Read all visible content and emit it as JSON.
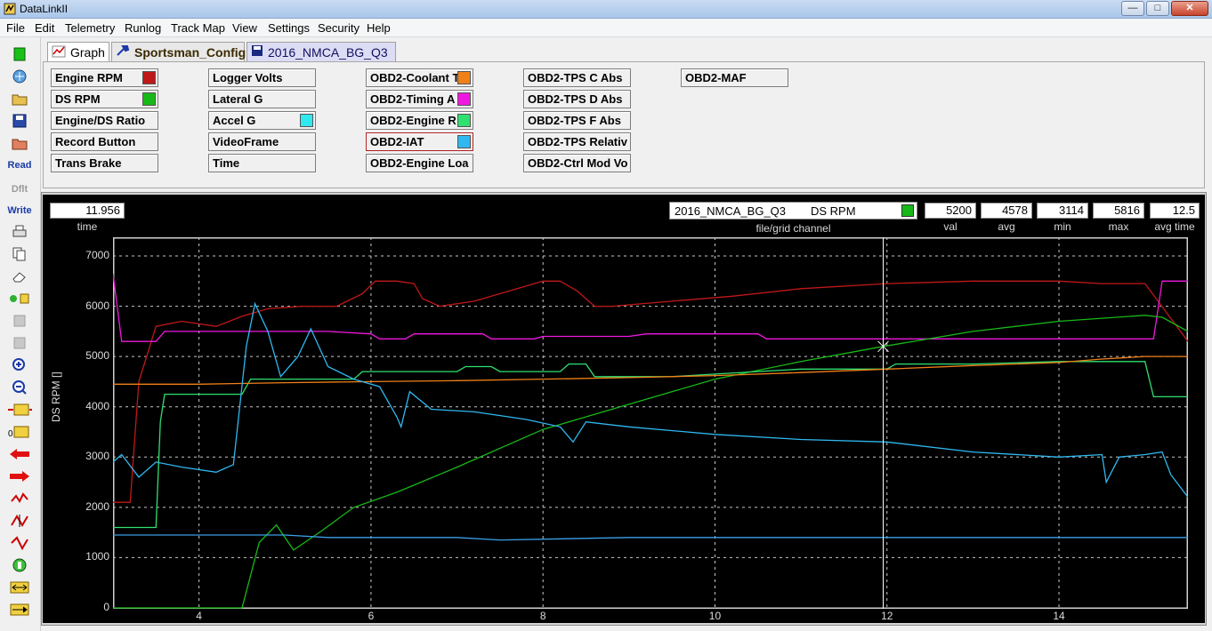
{
  "window": {
    "title": "DataLinkII",
    "min": "—",
    "max": "□",
    "close": "✕"
  },
  "menu": [
    "File",
    "Edit",
    "Telemetry",
    "Runlog",
    "Track Map",
    "View",
    "Settings",
    "Security",
    "Help"
  ],
  "toolbar": {
    "read": "Read",
    "dflt": "Dflt",
    "write": "Write"
  },
  "tabs": [
    {
      "label": "Graph",
      "icon": "graph-icon"
    },
    {
      "label": "Sportsman_Config",
      "icon": "wrench-icon"
    },
    {
      "label": "2016_NMCA_BG_Q3",
      "icon": "file-icon"
    }
  ],
  "channels": [
    {
      "label": "Engine RPM",
      "color": "#c01818"
    },
    {
      "label": "DS RPM",
      "color": "#18b818"
    },
    {
      "label": "Engine/DS Ratio",
      "color": ""
    },
    {
      "label": "Record Button",
      "color": ""
    },
    {
      "label": "Trans Brake",
      "color": ""
    },
    {
      "label": "Logger Volts",
      "color": ""
    },
    {
      "label": "Lateral G",
      "color": ""
    },
    {
      "label": "Accel G",
      "color": "#30e8f0"
    },
    {
      "label": "VideoFrame",
      "color": ""
    },
    {
      "label": "Time",
      "color": ""
    },
    {
      "label": "OBD2-Coolant T",
      "color": "#f08018"
    },
    {
      "label": "OBD2-Timing A",
      "color": "#f018e0"
    },
    {
      "label": "OBD2-Engine R",
      "color": "#30e070"
    },
    {
      "label": "OBD2-IAT",
      "color": "#30b8f0"
    },
    {
      "label": "OBD2-Engine Loa",
      "color": ""
    },
    {
      "label": "OBD2-TPS C Abs",
      "color": ""
    },
    {
      "label": "OBD2-TPS D Abs",
      "color": ""
    },
    {
      "label": "OBD2-TPS F Abs",
      "color": ""
    },
    {
      "label": "OBD2-TPS Relativ",
      "color": ""
    },
    {
      "label": "OBD2-Ctrl Mod Vo",
      "color": ""
    },
    {
      "label": "OBD2-MAF",
      "color": ""
    }
  ],
  "readout": {
    "time_value": "11.956",
    "time_label": "time",
    "channel_file": "2016_NMCA_BG_Q3",
    "channel_name": "DS RPM",
    "channel_color": "#18b818",
    "channel_label": "file/grid channel",
    "val": "5200",
    "val_label": "val",
    "avg": "4578",
    "avg_label": "avg",
    "min": "3114",
    "min_label": "min",
    "max": "5816",
    "max_label": "max",
    "avg_time": "12.5",
    "avg_time_label": "avg time"
  },
  "chart_data": {
    "type": "line",
    "ylabel": "DS RPM []",
    "xlim": [
      3.0,
      15.5
    ],
    "ylim": [
      0,
      7000
    ],
    "yticks": [
      0,
      1000,
      2000,
      3000,
      4000,
      5000,
      6000,
      7000
    ],
    "xticks": [
      4,
      6,
      8,
      10,
      12,
      14
    ],
    "grid": true,
    "cursor_x": 11.956,
    "series": [
      {
        "name": "Engine RPM",
        "color": "#c01818",
        "points": [
          [
            3.0,
            2100
          ],
          [
            3.2,
            2100
          ],
          [
            3.3,
            4500
          ],
          [
            3.5,
            5600
          ],
          [
            3.8,
            5700
          ],
          [
            4.2,
            5600
          ],
          [
            4.5,
            5800
          ],
          [
            4.8,
            5950
          ],
          [
            5.2,
            6000
          ],
          [
            5.6,
            6000
          ],
          [
            5.9,
            6250
          ],
          [
            6.05,
            6500
          ],
          [
            6.3,
            6500
          ],
          [
            6.5,
            6450
          ],
          [
            6.6,
            6150
          ],
          [
            6.8,
            6000
          ],
          [
            7.2,
            6100
          ],
          [
            7.6,
            6300
          ],
          [
            8.0,
            6500
          ],
          [
            8.2,
            6500
          ],
          [
            8.4,
            6300
          ],
          [
            8.6,
            6000
          ],
          [
            8.8,
            6000
          ],
          [
            9.5,
            6100
          ],
          [
            10.2,
            6200
          ],
          [
            11.0,
            6350
          ],
          [
            12.0,
            6450
          ],
          [
            13.0,
            6500
          ],
          [
            14.0,
            6500
          ],
          [
            14.5,
            6450
          ],
          [
            15.0,
            6450
          ],
          [
            15.5,
            5300
          ]
        ]
      },
      {
        "name": "OBD2-Timing A",
        "color": "#f018e0",
        "points": [
          [
            3.0,
            6650
          ],
          [
            3.1,
            5300
          ],
          [
            3.5,
            5300
          ],
          [
            3.6,
            5500
          ],
          [
            4.5,
            5500
          ],
          [
            5.5,
            5500
          ],
          [
            6.0,
            5450
          ],
          [
            6.1,
            5350
          ],
          [
            6.4,
            5350
          ],
          [
            6.5,
            5450
          ],
          [
            7.3,
            5450
          ],
          [
            7.4,
            5350
          ],
          [
            7.9,
            5350
          ],
          [
            8.0,
            5400
          ],
          [
            9.0,
            5400
          ],
          [
            9.2,
            5450
          ],
          [
            10.5,
            5450
          ],
          [
            10.6,
            5350
          ],
          [
            11.5,
            5350
          ],
          [
            12.0,
            5350
          ],
          [
            14.0,
            5350
          ],
          [
            15.1,
            5350
          ],
          [
            15.2,
            6500
          ],
          [
            15.5,
            6500
          ]
        ]
      },
      {
        "name": "DS RPM",
        "color": "#18b818",
        "points": [
          [
            3.0,
            0
          ],
          [
            4.5,
            0
          ],
          [
            4.7,
            1300
          ],
          [
            4.9,
            1650
          ],
          [
            5.1,
            1150
          ],
          [
            5.4,
            1500
          ],
          [
            5.8,
            2000
          ],
          [
            6.3,
            2300
          ],
          [
            7.0,
            2800
          ],
          [
            8.0,
            3550
          ],
          [
            9.0,
            4050
          ],
          [
            10.0,
            4550
          ],
          [
            11.0,
            4900
          ],
          [
            11.956,
            5200
          ],
          [
            13.0,
            5500
          ],
          [
            14.0,
            5700
          ],
          [
            15.0,
            5820
          ],
          [
            15.2,
            5780
          ],
          [
            15.5,
            5500
          ]
        ]
      },
      {
        "name": "OBD2-Engine R",
        "color": "#30e070",
        "points": [
          [
            3.0,
            1600
          ],
          [
            3.5,
            1600
          ],
          [
            3.55,
            3700
          ],
          [
            3.6,
            4250
          ],
          [
            4.5,
            4250
          ],
          [
            4.6,
            4550
          ],
          [
            5.8,
            4550
          ],
          [
            5.9,
            4700
          ],
          [
            7.0,
            4700
          ],
          [
            7.1,
            4800
          ],
          [
            7.4,
            4800
          ],
          [
            7.5,
            4700
          ],
          [
            8.2,
            4700
          ],
          [
            8.3,
            4850
          ],
          [
            8.5,
            4850
          ],
          [
            8.6,
            4600
          ],
          [
            9.5,
            4600
          ],
          [
            10.0,
            4650
          ],
          [
            11.0,
            4750
          ],
          [
            12.0,
            4750
          ],
          [
            12.1,
            4850
          ],
          [
            13.0,
            4850
          ],
          [
            14.0,
            4900
          ],
          [
            15.0,
            4900
          ],
          [
            15.1,
            4200
          ],
          [
            15.5,
            4200
          ]
        ]
      },
      {
        "name": "OBD2-Coolant T",
        "color": "#f08018",
        "points": [
          [
            3.0,
            4450
          ],
          [
            4.0,
            4450
          ],
          [
            5.0,
            4480
          ],
          [
            6.0,
            4500
          ],
          [
            7.0,
            4520
          ],
          [
            8.0,
            4550
          ],
          [
            9.0,
            4580
          ],
          [
            10.0,
            4620
          ],
          [
            11.0,
            4680
          ],
          [
            12.0,
            4750
          ],
          [
            13.0,
            4820
          ],
          [
            14.0,
            4880
          ],
          [
            14.5,
            4950
          ],
          [
            15.0,
            5000
          ],
          [
            15.5,
            5000
          ]
        ]
      },
      {
        "name": "OBD2-IAT",
        "color": "#30b8f0",
        "points": [
          [
            3.0,
            2900
          ],
          [
            3.1,
            3050
          ],
          [
            3.3,
            2600
          ],
          [
            3.5,
            2900
          ],
          [
            3.8,
            2800
          ],
          [
            4.2,
            2700
          ],
          [
            4.4,
            2850
          ],
          [
            4.55,
            5200
          ],
          [
            4.65,
            6050
          ],
          [
            4.8,
            5500
          ],
          [
            4.95,
            4600
          ],
          [
            5.15,
            5000
          ],
          [
            5.3,
            5550
          ],
          [
            5.5,
            4800
          ],
          [
            5.8,
            4550
          ],
          [
            6.1,
            4400
          ],
          [
            6.3,
            3800
          ],
          [
            6.35,
            3600
          ],
          [
            6.45,
            4300
          ],
          [
            6.7,
            3950
          ],
          [
            7.2,
            3900
          ],
          [
            7.8,
            3750
          ],
          [
            8.2,
            3600
          ],
          [
            8.35,
            3300
          ],
          [
            8.5,
            3700
          ],
          [
            9.0,
            3600
          ],
          [
            10.0,
            3450
          ],
          [
            11.0,
            3350
          ],
          [
            12.0,
            3300
          ],
          [
            13.0,
            3100
          ],
          [
            14.0,
            3000
          ],
          [
            14.5,
            3050
          ],
          [
            14.55,
            2500
          ],
          [
            14.7,
            3000
          ],
          [
            15.0,
            3050
          ],
          [
            15.2,
            3100
          ],
          [
            15.3,
            2650
          ],
          [
            15.5,
            2200
          ]
        ]
      },
      {
        "name": "Logger Volts",
        "color": "#3aa0e8",
        "points": [
          [
            3.0,
            1450
          ],
          [
            5.0,
            1450
          ],
          [
            5.5,
            1400
          ],
          [
            7.0,
            1400
          ],
          [
            7.5,
            1350
          ],
          [
            9.0,
            1400
          ],
          [
            10.0,
            1400
          ],
          [
            15.5,
            1400
          ]
        ]
      }
    ]
  }
}
